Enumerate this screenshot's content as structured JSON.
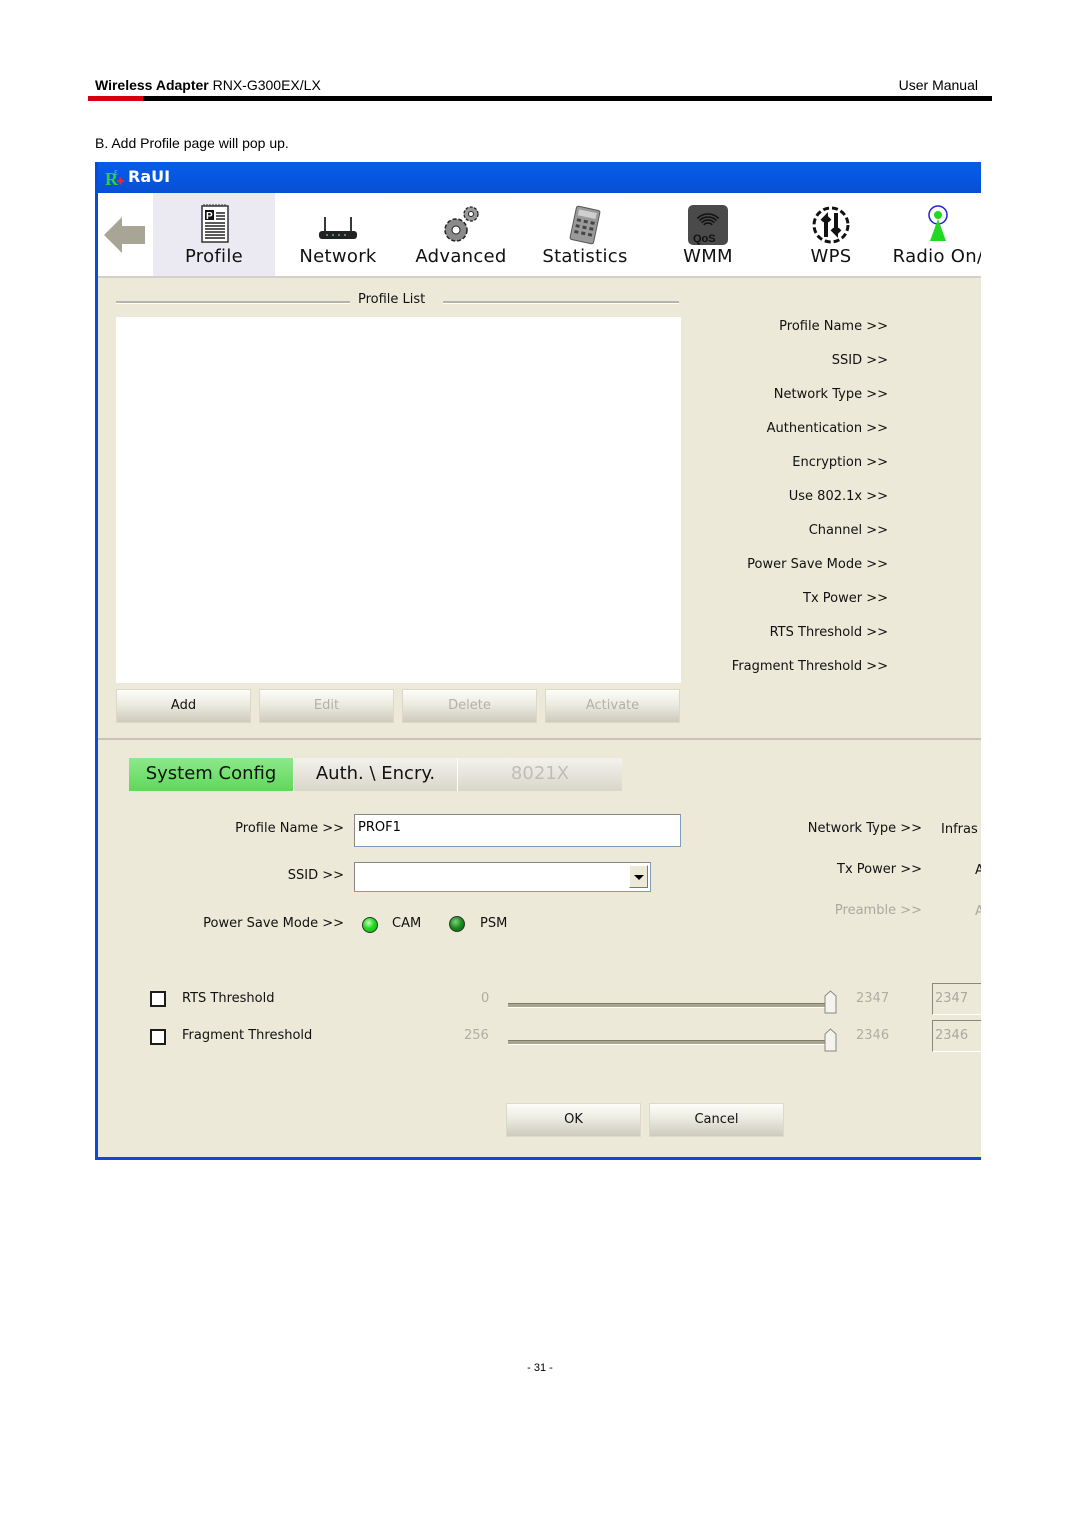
{
  "doc": {
    "header_left_bold": "Wireless Adapter",
    "header_left_model": " RNX-G300EX/LX",
    "header_right": "User Manual",
    "intro": "B. Add Profile page will pop up.",
    "page_number": "- 31 -",
    "colors": {
      "accent_red": "#d7000f",
      "titlebar_blue": "#0555e0",
      "active_tab_green": "#5fd85b"
    }
  },
  "window": {
    "title": "RaUI",
    "toolbar": [
      {
        "label": "Profile",
        "icon": "profile-document-icon",
        "active": true
      },
      {
        "label": "Network",
        "icon": "router-icon",
        "active": false
      },
      {
        "label": "Advanced",
        "icon": "gears-icon",
        "active": false
      },
      {
        "label": "Statistics",
        "icon": "calculator-icon",
        "active": false
      },
      {
        "label": "WMM",
        "icon": "qos-signal-icon",
        "active": false
      },
      {
        "label": "WPS",
        "icon": "wps-arrows-icon",
        "active": false
      },
      {
        "label": "Radio On/",
        "icon": "radio-antenna-icon",
        "active": false
      }
    ],
    "profile_list": {
      "legend": "Profile List",
      "items": [],
      "info_labels": [
        "Profile Name >>",
        "SSID >>",
        "Network Type >>",
        "Authentication >>",
        "Encryption >>",
        "Use 802.1x >>",
        "Channel >>",
        "Power Save Mode >>",
        "Tx Power >>",
        "RTS Threshold >>",
        "Fragment Threshold >>"
      ],
      "buttons": [
        {
          "label": "Add",
          "enabled": true
        },
        {
          "label": "Edit",
          "enabled": false
        },
        {
          "label": "Delete",
          "enabled": false
        },
        {
          "label": "Activate",
          "enabled": false
        }
      ]
    },
    "tabs": [
      {
        "label": "System Config",
        "state": "active"
      },
      {
        "label": "Auth. \\ Encry.",
        "state": "inactive"
      },
      {
        "label": "8021X",
        "state": "disabled"
      }
    ],
    "system_config": {
      "profile_name_label": "Profile Name >>",
      "profile_name_value": "PROF1",
      "ssid_label": "SSID >>",
      "ssid_value": "",
      "power_save_label": "Power Save Mode >>",
      "power_save_options": [
        {
          "label": "CAM",
          "selected": true
        },
        {
          "label": "PSM",
          "selected": false
        }
      ],
      "network_type_label": "Network Type >>",
      "network_type_value": "Infras",
      "tx_power_label": "Tx Power >>",
      "tx_power_value": "A",
      "preamble_label": "Preamble >>",
      "preamble_value": "A",
      "rts": {
        "label": "RTS Threshold",
        "checked": false,
        "min": "0",
        "max": "2347",
        "value": "2347",
        "fraction": 1.0
      },
      "fragment": {
        "label": "Fragment Threshold",
        "checked": false,
        "min": "256",
        "max": "2346",
        "value": "2346",
        "fraction": 1.0
      },
      "ok_label": "OK",
      "cancel_label": "Cancel"
    }
  }
}
